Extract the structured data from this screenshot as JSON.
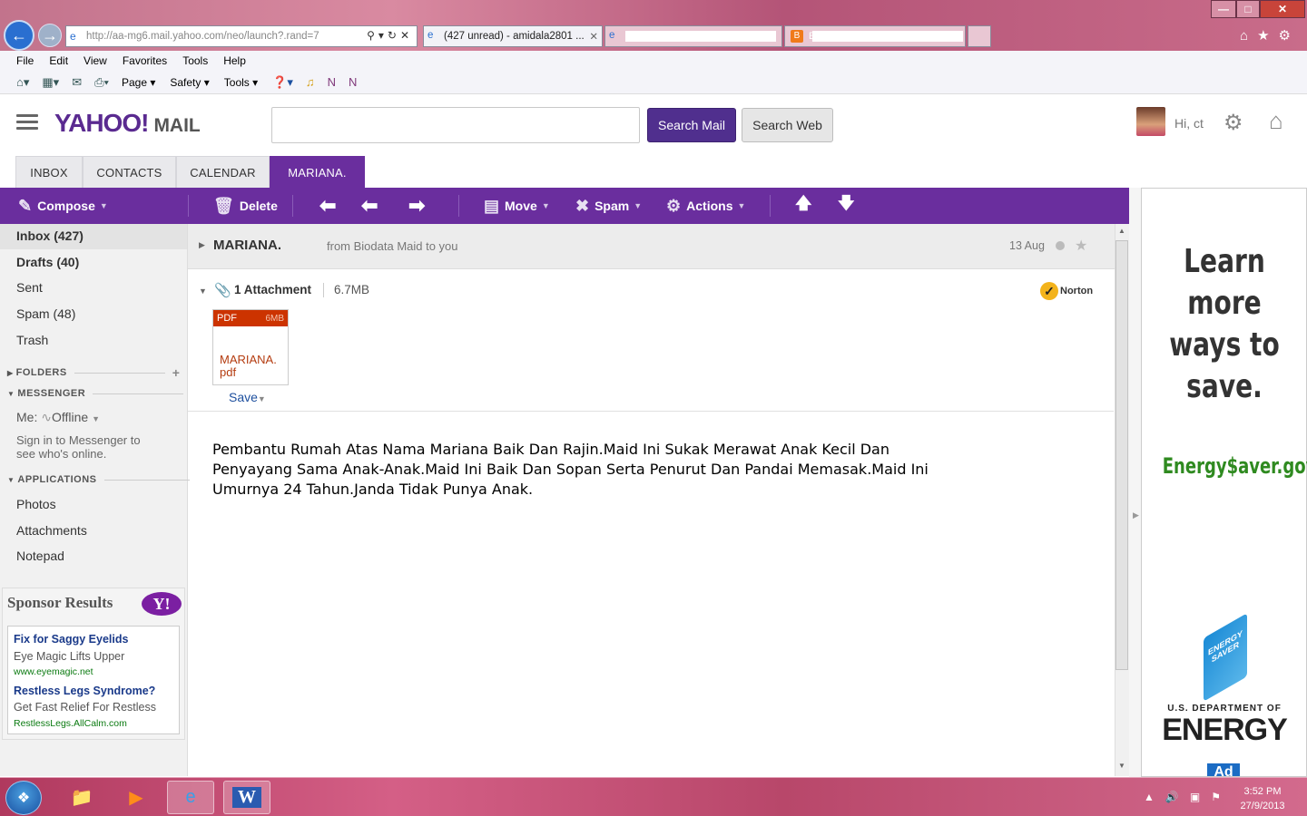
{
  "browser": {
    "address": "http://aa-mg6.mail.yahoo.com/neo/launch?.rand=7",
    "tabs": [
      {
        "label": "(427 unread) - amidala2801 ..."
      },
      {
        "label": ""
      },
      {
        "label": "E"
      },
      {
        "label": ""
      }
    ],
    "menu": [
      "File",
      "Edit",
      "View",
      "Favorites",
      "Tools",
      "Help"
    ],
    "commands": [
      "Page",
      "Safety",
      "Tools"
    ]
  },
  "header": {
    "logo": "YAHOO!",
    "logo_suffix": "MAIL",
    "search_placeholder": "",
    "search_mail": "Search Mail",
    "search_web": "Search Web",
    "greeting": "Hi, ct"
  },
  "tabs": [
    "INBOX",
    "CONTACTS",
    "CALENDAR",
    "MARIANA."
  ],
  "toolbar": {
    "compose": "Compose",
    "delete": "Delete",
    "move": "Move",
    "spam": "Spam",
    "actions": "Actions"
  },
  "sidebar": {
    "folders": [
      {
        "label": "Inbox (427)"
      },
      {
        "label": "Drafts (40)"
      },
      {
        "label": "Sent"
      },
      {
        "label": "Spam (48)"
      },
      {
        "label": "Trash"
      }
    ],
    "folders_header": "FOLDERS",
    "messenger_header": "MESSENGER",
    "me_label": "Me:",
    "status": "Offline",
    "messenger_note_1": "Sign in to Messenger to",
    "messenger_note_2": "see who's online.",
    "applications_header": "APPLICATIONS",
    "apps": [
      "Photos",
      "Attachments",
      "Notepad"
    ],
    "sponsor_title": "Sponsor Results",
    "ads": [
      {
        "title": "Fix for Saggy Eyelids",
        "desc": "Eye Magic Lifts Upper",
        "url": "www.eyemagic.net"
      },
      {
        "title": "Restless Legs Syndrome?",
        "desc": "Get Fast Relief For Restless",
        "url": "RestlessLegs.AllCalm.com"
      }
    ]
  },
  "message": {
    "subject": "MARIANA.",
    "from": "from Biodata Maid to you",
    "date": "13 Aug",
    "attachment_count": "1 Attachment",
    "attachment_size": "6.7MB",
    "norton": "Norton",
    "file_type": "PDF",
    "file_size": "6MB",
    "file_name_1": "MARIANA.",
    "file_name_2": "pdf",
    "save": "Save",
    "body": "Pembantu Rumah Atas Nama Mariana Baik Dan Rajin.Maid Ini Sukak Merawat Anak Kecil Dan Penyayang Sama Anak-Anak.Maid Ini Baik Dan Sopan Serta Penurut Dan Pandai Memasak.Maid Ini Umurnya 24 Tahun.Janda Tidak Punya Anak."
  },
  "ad": {
    "headline": "Learn more ways to save.",
    "site": "Energy$aver.gov",
    "logo_text": "ENERGY SAVER",
    "dept": "U.S. DEPARTMENT OF",
    "dept_name": "ENERGY",
    "ad_label": "Ad"
  },
  "taskbar": {
    "time": "3:52 PM",
    "date": "27/9/2013"
  }
}
